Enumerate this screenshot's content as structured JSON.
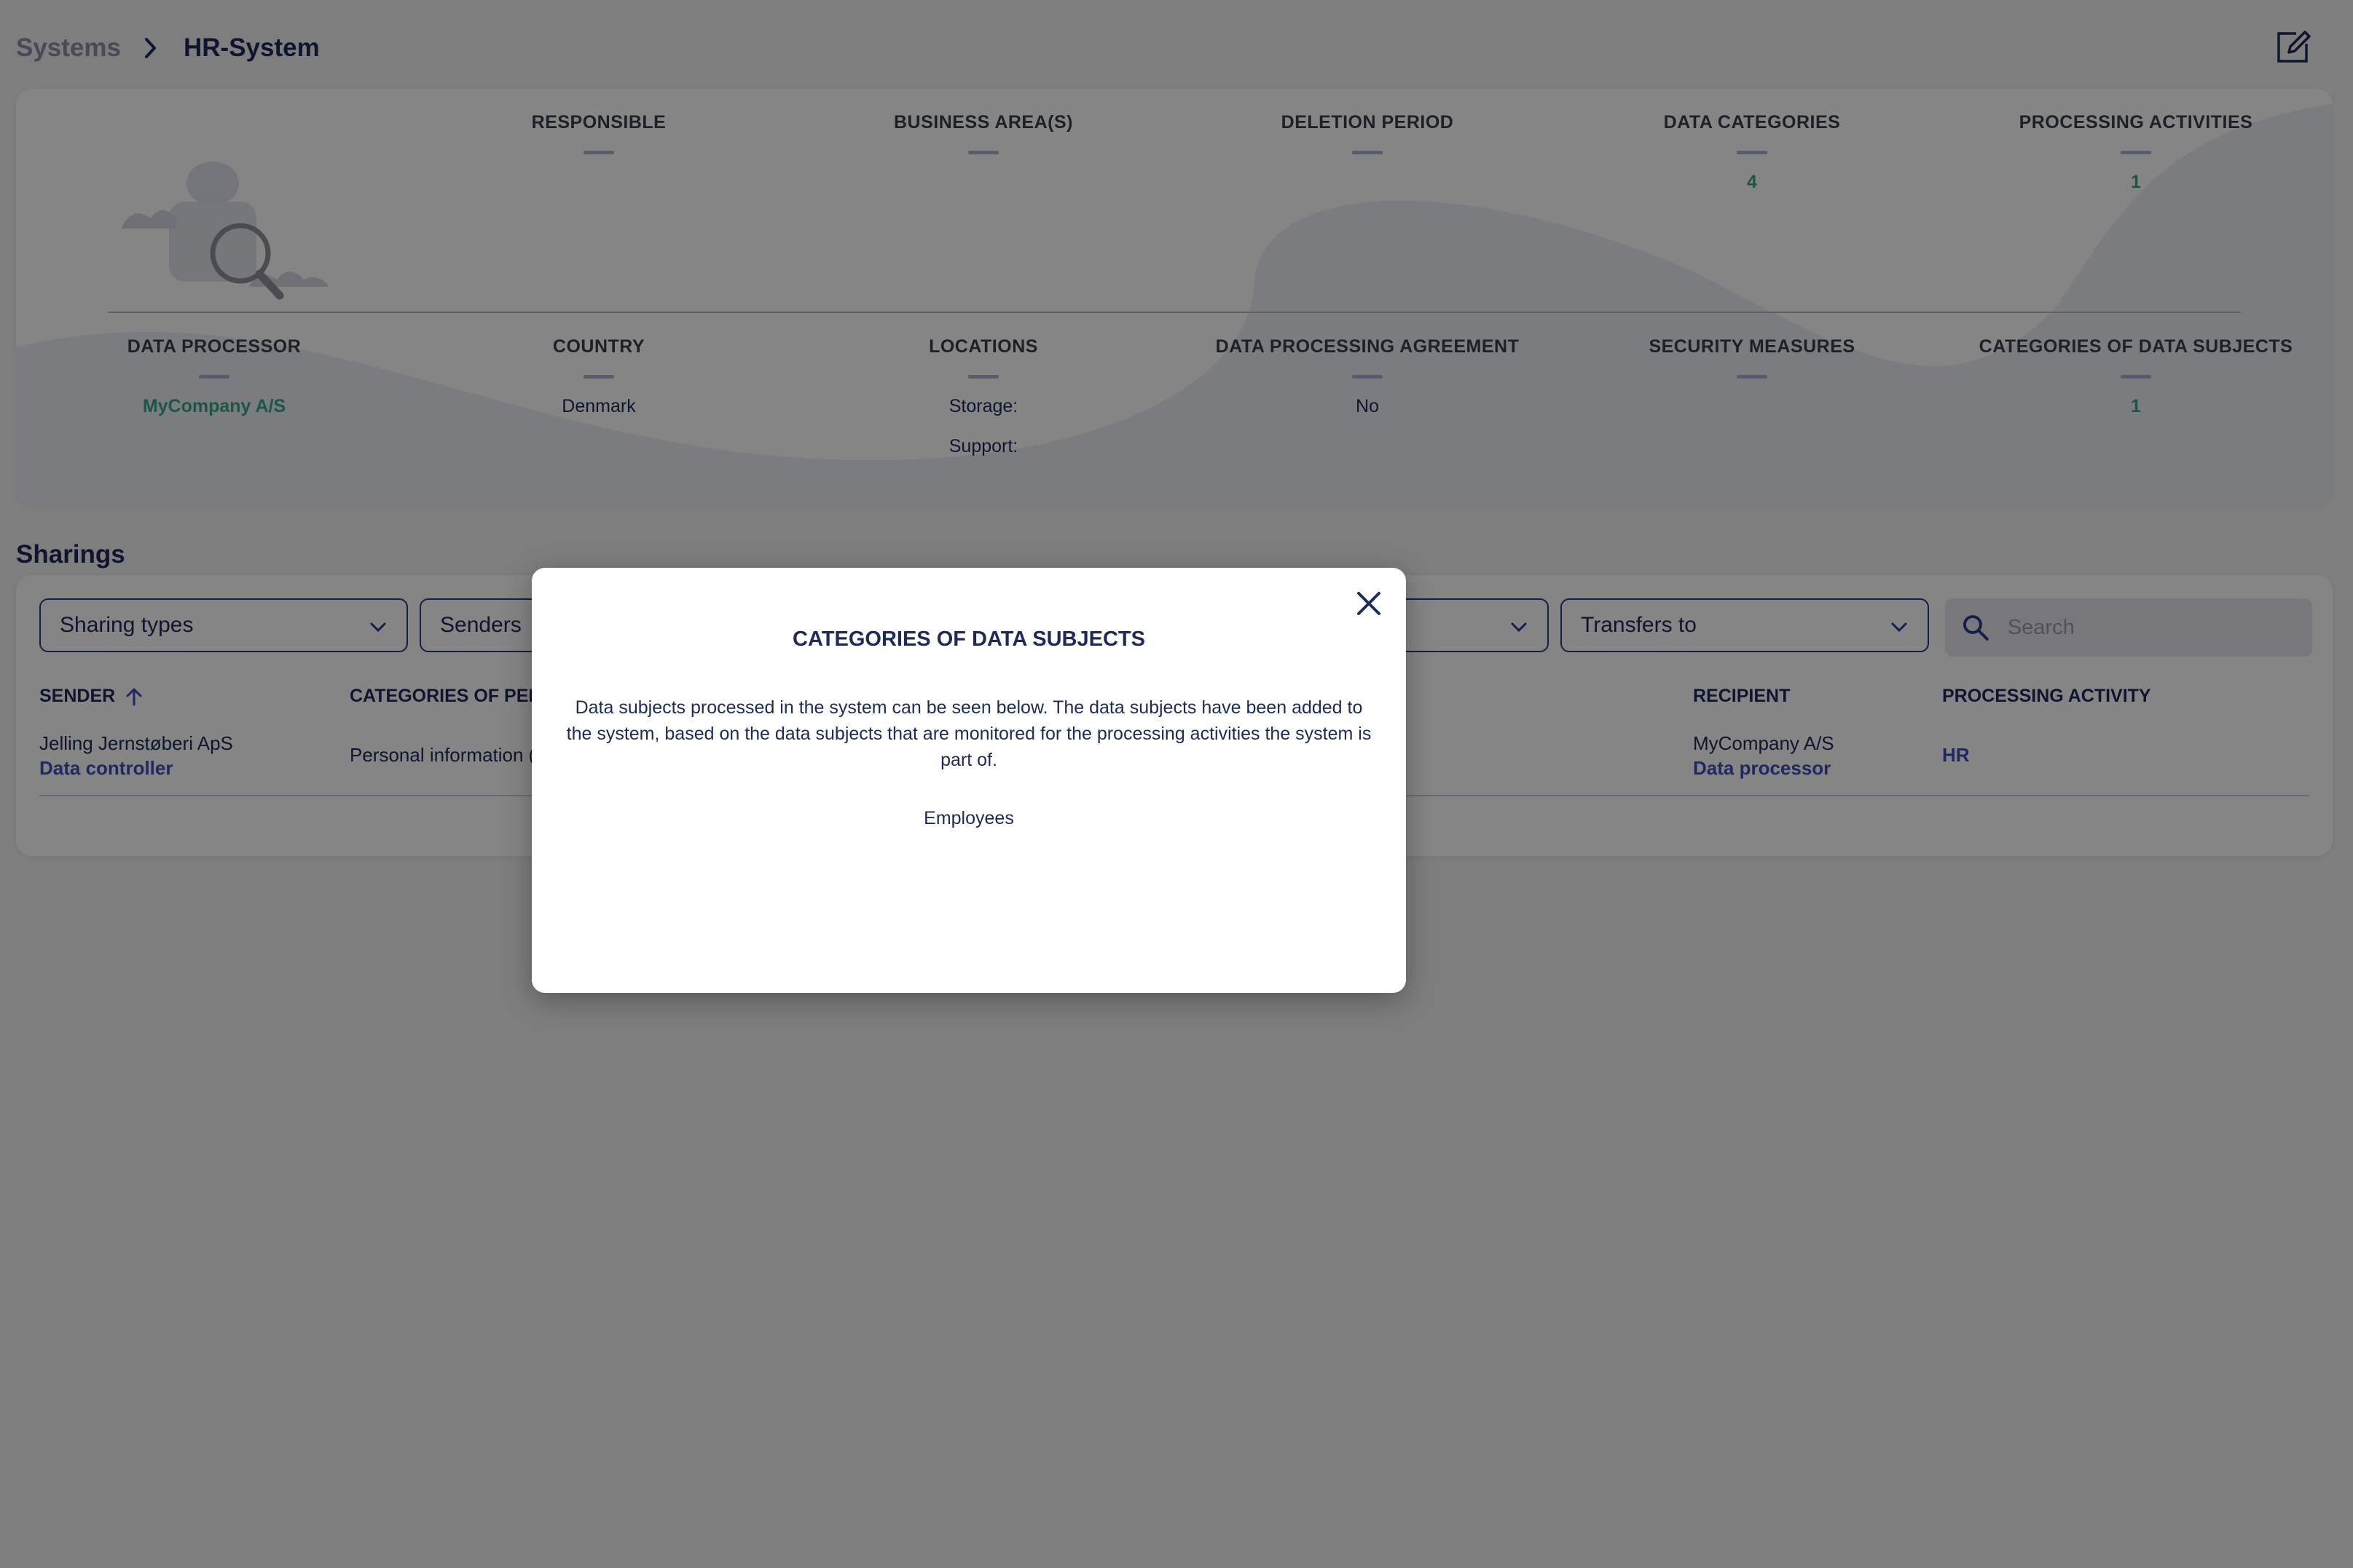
{
  "breadcrumb": {
    "parent": "Systems",
    "current": "HR-System"
  },
  "icons": {
    "separator": "chevron-right-icon",
    "edit": "edit-icon",
    "close": "close-icon",
    "search": "search-icon",
    "dropdown": "chevron-down-icon",
    "sort": "arrow-up-icon"
  },
  "overview": {
    "row1": [
      {
        "label": "RESPONSIBLE",
        "value": ""
      },
      {
        "label": "BUSINESS AREA(S)",
        "value": ""
      },
      {
        "label": "DELETION PERIOD",
        "value": ""
      },
      {
        "label": "DATA CATEGORIES",
        "value": "4"
      },
      {
        "label": "PROCESSING ACTIVITIES",
        "value": "1"
      }
    ],
    "row2": [
      {
        "label": "DATA PROCESSOR",
        "value": "MyCompany A/S"
      },
      {
        "label": "COUNTRY",
        "value": "Denmark"
      },
      {
        "label": "LOCATIONS",
        "value": "Storage:",
        "value2": "Support:"
      },
      {
        "label": "DATA PROCESSING AGREEMENT",
        "value": "No"
      },
      {
        "label": "SECURITY MEASURES",
        "value": ""
      },
      {
        "label": "CATEGORIES OF DATA SUBJECTS",
        "value": "1"
      }
    ]
  },
  "sharings": {
    "title": "Sharings",
    "filters": {
      "sharing_types": "Sharing types",
      "senders": "Senders",
      "transfers_to": "Transfers to"
    },
    "search_placeholder": "Search",
    "columns": {
      "sender": "SENDER",
      "categories": "CATEGORIES OF PERS",
      "recipient": "RECIPIENT",
      "processing_activity": "PROCESSING ACTIVITY"
    },
    "rows": [
      {
        "sender": "Jelling Jernstøberi ApS",
        "sender_role": "Data controller",
        "categories": "Personal information (",
        "recipient": "MyCompany A/S",
        "recipient_role": "Data processor",
        "processing_activity": "HR"
      }
    ]
  },
  "modal": {
    "title": "CATEGORIES OF DATA SUBJECTS",
    "body": "Data subjects processed in the system can be seen below. The data subjects have been added to the system, based on the data subjects that are monitored for the processing activities the system is part of.",
    "items": [
      "Employees"
    ]
  }
}
